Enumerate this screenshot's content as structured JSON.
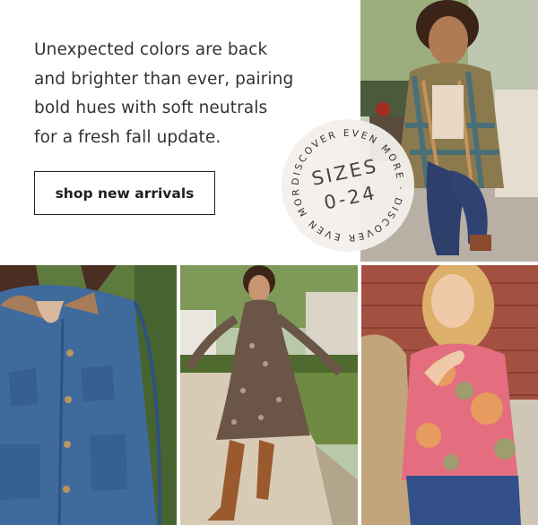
{
  "promo": {
    "copy_lines": [
      "Unexpected colors are back",
      "and brighter than ever, pairing",
      "bold hues with soft neutrals",
      "for a fresh fall update."
    ],
    "cta_label": "shop new arrivals"
  },
  "badge": {
    "ring_text": "DISCOVER EVEN MORE · DISCOVER EVEN MORE ·",
    "line1": "SIZES",
    "line2": "0-24"
  },
  "colors": {
    "text": "#333333",
    "button_border": "#222222",
    "badge_bg": "#f3f0ec"
  }
}
